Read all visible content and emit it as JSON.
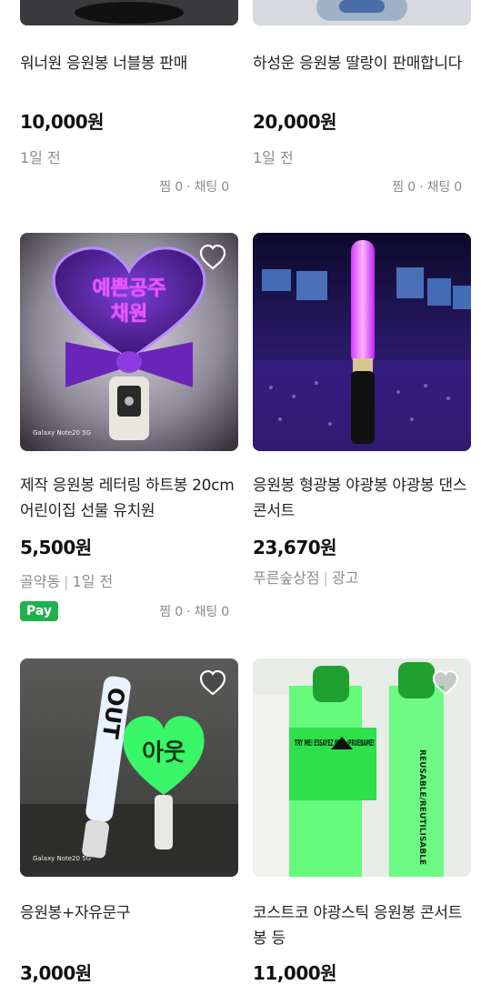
{
  "items": [
    {
      "title": "워너원 응원봉 너블봉 판매",
      "price": "10,000원",
      "time": "1일 전",
      "counts": "찜 0 · 채팅 0"
    },
    {
      "title": "하성운 응원봉 딸랑이 판매합니다",
      "price": "20,000원",
      "time": "1일 전",
      "counts": "찜 0 · 채팅 0"
    },
    {
      "title": "제작 응원봉 레터링 하트봉 20cm 어린이집 선물 유치원",
      "price": "5,500원",
      "location": "골약동",
      "time": "1일 전",
      "badge": "Pay",
      "counts": "찜 0 · 채팅 0",
      "image_text": {
        "heart_line1": "예쁜공주",
        "heart_line2": "채원",
        "watermark": "Galaxy Note20 5G"
      }
    },
    {
      "title": "응원봉 형광봉 야광봉 야광봉 댄스 콘서트",
      "price": "23,670원",
      "store": "푸른숲상점",
      "ad_label": "광고"
    },
    {
      "title": "응원봉+자유문구",
      "price": "3,000원",
      "image_text": {
        "stick": "OUT",
        "heart": "아웃",
        "watermark": "Galaxy Note20 5G"
      }
    },
    {
      "title": "코스트코 야광스틱 응원봉 콘서트봉 등",
      "price": "11,000원",
      "image_text": {
        "sign": "TRY ME! ESSAYEZ MOI! ¡PRUEBAME!",
        "side": "REUSABLE/REUTILISABLE"
      }
    }
  ],
  "colors": {
    "pay_badge": "#1fb14d",
    "meta_text": "#8d8d8d"
  },
  "icons": [
    "heart-icon"
  ]
}
